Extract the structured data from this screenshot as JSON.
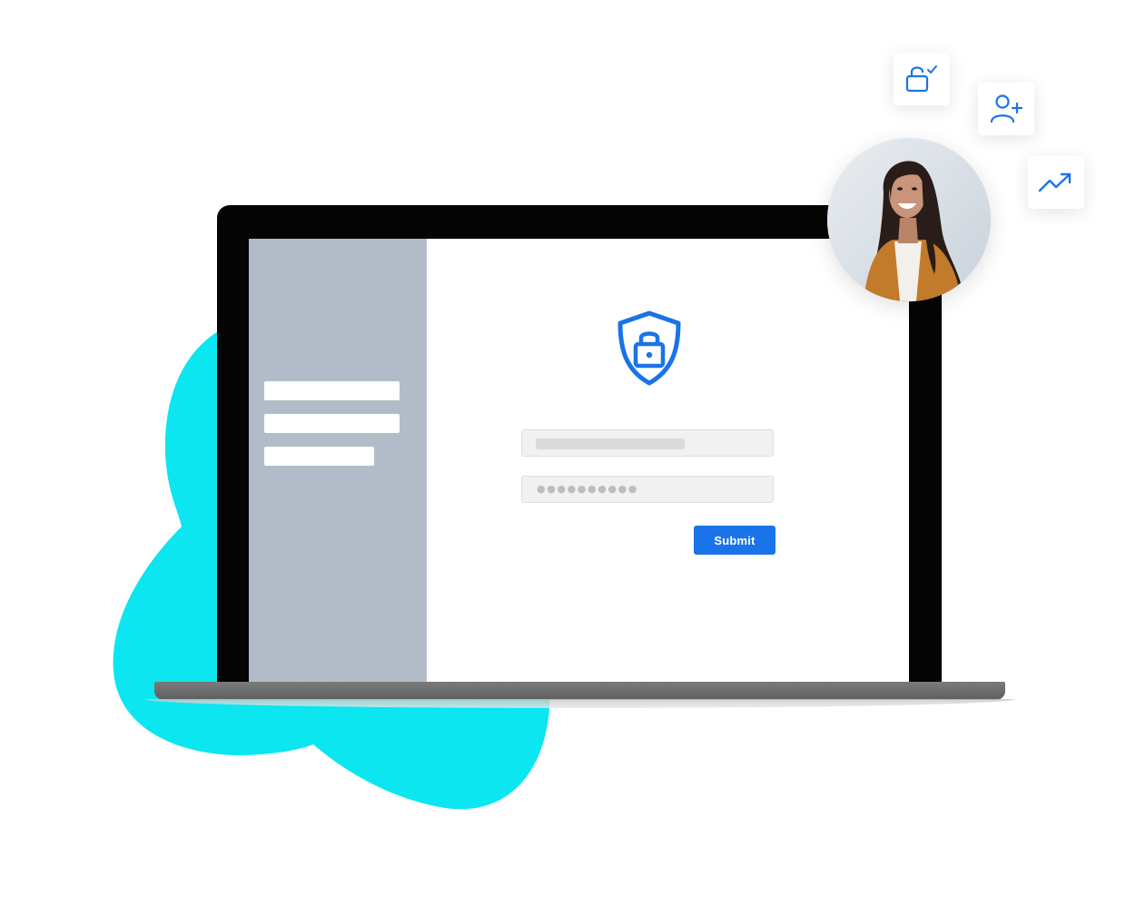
{
  "colors": {
    "accent": "#1a73e8",
    "blob": "#0be6f0",
    "sidebar": "#b2bcc9",
    "laptop_frame": "#050505"
  },
  "login_form": {
    "password_mask": "●●●●●●●●●●",
    "submit_label": "Submit"
  },
  "icons": {
    "shield": "shield-lock-icon",
    "floating": [
      "unlock-check-icon",
      "user-add-icon",
      "trending-up-icon"
    ]
  }
}
